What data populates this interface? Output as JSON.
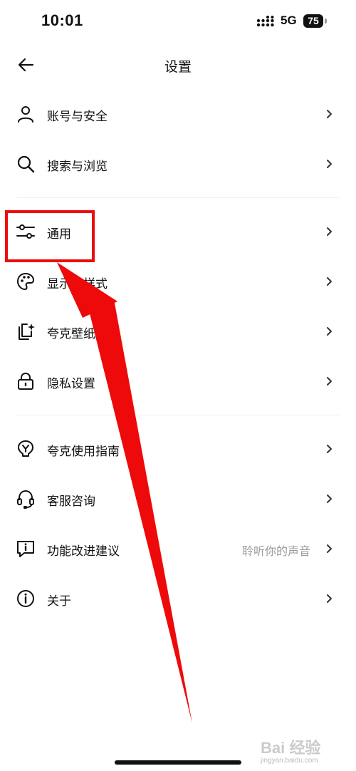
{
  "status_bar": {
    "time": "10:01",
    "network": "5G",
    "battery": "75"
  },
  "nav": {
    "title": "设置"
  },
  "sections": [
    {
      "items": [
        {
          "label": "账号与安全",
          "icon": "user-icon"
        },
        {
          "label": "搜索与浏览",
          "icon": "search-icon"
        }
      ]
    },
    {
      "items": [
        {
          "label": "通用",
          "icon": "sliders-icon"
        },
        {
          "label": "显示与样式",
          "icon": "palette-icon"
        },
        {
          "label": "夸克壁纸",
          "icon": "wallpaper-icon"
        },
        {
          "label": "隐私设置",
          "icon": "lock-icon"
        }
      ]
    },
    {
      "items": [
        {
          "label": "夸克使用指南",
          "icon": "guide-icon"
        },
        {
          "label": "客服咨询",
          "icon": "headset-icon"
        },
        {
          "label": "功能改进建议",
          "icon": "feedback-icon",
          "hint": "聆听你的声音"
        },
        {
          "label": "关于",
          "icon": "info-icon"
        }
      ]
    }
  ],
  "annotation": {
    "highlight_color": "#ee0a0a",
    "highlighted_item": "通用"
  },
  "watermark": {
    "text": "Bai 经验",
    "url": "jingyan.baidu.com"
  }
}
